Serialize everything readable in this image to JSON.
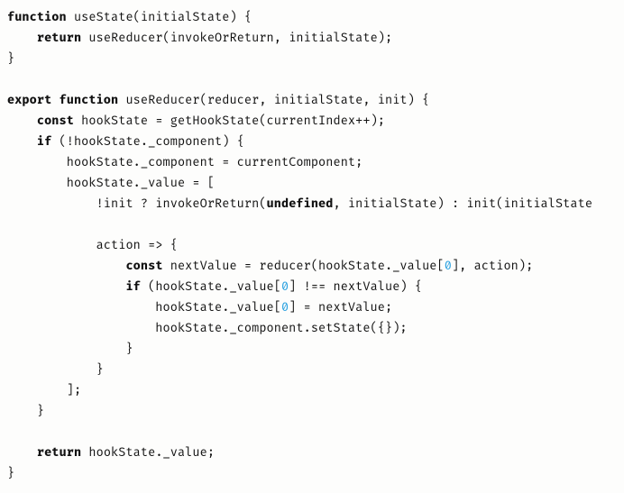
{
  "code": {
    "tokens": [
      [
        [
          "kw",
          "function"
        ],
        [
          "pl",
          " useState(initialState) {"
        ]
      ],
      [
        [
          "pl",
          "    "
        ],
        [
          "kw",
          "return"
        ],
        [
          "pl",
          " useReducer(invokeOrReturn, initialState);"
        ]
      ],
      [
        [
          "pl",
          "}"
        ]
      ],
      [],
      [
        [
          "kw",
          "export function"
        ],
        [
          "pl",
          " useReducer(reducer, initialState, init) {"
        ]
      ],
      [
        [
          "pl",
          "    "
        ],
        [
          "kw",
          "const"
        ],
        [
          "pl",
          " hookState = getHookState(currentIndex++);"
        ]
      ],
      [
        [
          "pl",
          "    "
        ],
        [
          "kw",
          "if"
        ],
        [
          "pl",
          " (!hookState._component) {"
        ]
      ],
      [
        [
          "pl",
          "        hookState._component = currentComponent;"
        ]
      ],
      [
        [
          "pl",
          "        hookState._value = ["
        ]
      ],
      [
        [
          "pl",
          "            !init ? invokeOrReturn("
        ],
        [
          "kw",
          "undefined"
        ],
        [
          "pl",
          ", initialState) : init(initialState"
        ]
      ],
      [],
      [
        [
          "pl",
          "            action => {"
        ]
      ],
      [
        [
          "pl",
          "                "
        ],
        [
          "kw",
          "const"
        ],
        [
          "pl",
          " nextValue = reducer(hookState._value["
        ],
        [
          "num",
          "0"
        ],
        [
          "pl",
          "], action);"
        ]
      ],
      [
        [
          "pl",
          "                "
        ],
        [
          "kw",
          "if"
        ],
        [
          "pl",
          " (hookState._value["
        ],
        [
          "num",
          "0"
        ],
        [
          "pl",
          "] !== nextValue) {"
        ]
      ],
      [
        [
          "pl",
          "                    hookState._value["
        ],
        [
          "num",
          "0"
        ],
        [
          "pl",
          "] = nextValue;"
        ]
      ],
      [
        [
          "pl",
          "                    hookState._component.setState({});"
        ]
      ],
      [
        [
          "pl",
          "                }"
        ]
      ],
      [
        [
          "pl",
          "            }"
        ]
      ],
      [
        [
          "pl",
          "        ];"
        ]
      ],
      [
        [
          "pl",
          "    }"
        ]
      ],
      [],
      [
        [
          "pl",
          "    "
        ],
        [
          "kw",
          "return"
        ],
        [
          "pl",
          " hookState._value;"
        ]
      ],
      [
        [
          "pl",
          "}"
        ]
      ]
    ]
  }
}
